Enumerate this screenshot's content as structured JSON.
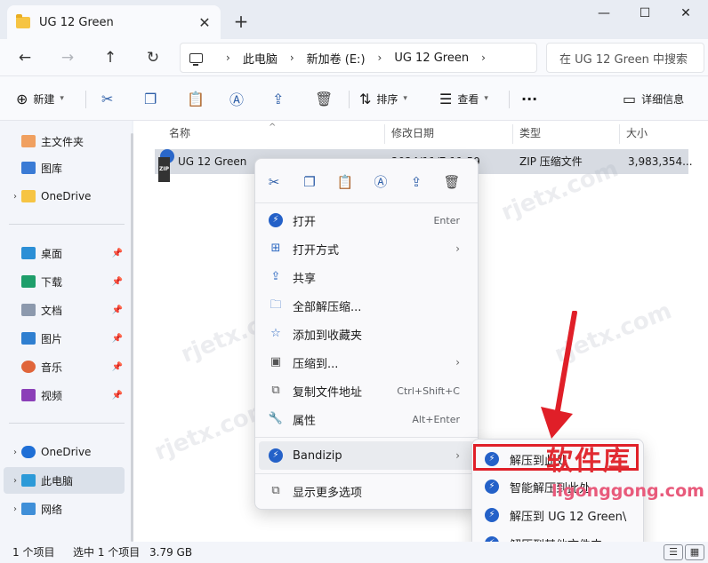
{
  "window": {
    "tab_title": "UG 12 Green",
    "tab_close": "✕",
    "new_tab": "+",
    "minimize": "—",
    "maximize": "☐",
    "close": "✕"
  },
  "nav": {
    "back": "←",
    "forward": "→",
    "up": "↑",
    "refresh": "↻",
    "breadcrumb": [
      "此电脑",
      "新加卷 (E:)",
      "UG 12 Green"
    ],
    "search_placeholder": "在 UG 12 Green 中搜索"
  },
  "toolbar": {
    "new_label": "新建",
    "sort_label": "排序",
    "view_label": "查看",
    "more": "···",
    "details_label": "详细信息"
  },
  "sidebar": {
    "items": [
      {
        "label": "主文件夹"
      },
      {
        "label": "图库"
      },
      {
        "label": "OneDrive"
      },
      {
        "label": "桌面"
      },
      {
        "label": "下载"
      },
      {
        "label": "文档"
      },
      {
        "label": "图片"
      },
      {
        "label": "音乐"
      },
      {
        "label": "视频"
      },
      {
        "label": "OneDrive"
      },
      {
        "label": "此电脑"
      },
      {
        "label": "网络"
      }
    ]
  },
  "columns": {
    "name": "名称",
    "modified": "修改日期",
    "type": "类型",
    "size": "大小"
  },
  "file": {
    "name": "UG 12 Green",
    "modified": "2024/11/7 11:59",
    "type": "ZIP 压缩文件",
    "size": "3,983,354..."
  },
  "status": {
    "count": "1 个项目",
    "selected": "选中 1 个项目",
    "size": "3.79 GB"
  },
  "context_menu": {
    "items": [
      {
        "label": "打开",
        "shortcut": "Enter"
      },
      {
        "label": "打开方式",
        "shortcut": ""
      },
      {
        "label": "共享",
        "shortcut": ""
      },
      {
        "label": "全部解压缩...",
        "shortcut": ""
      },
      {
        "label": "添加到收藏夹",
        "shortcut": ""
      },
      {
        "label": "压缩到...",
        "shortcut": ""
      },
      {
        "label": "复制文件地址",
        "shortcut": "Ctrl+Shift+C"
      },
      {
        "label": "属性",
        "shortcut": "Alt+Enter"
      },
      {
        "label": "Bandizip",
        "shortcut": ""
      },
      {
        "label": "显示更多选项",
        "shortcut": ""
      }
    ]
  },
  "submenu": {
    "items": [
      {
        "label": "解压到此处"
      },
      {
        "label": "智能解压到此处"
      },
      {
        "label": "解压到 UG 12 Green\\"
      },
      {
        "label": "解压到其他文件夹..."
      }
    ]
  },
  "watermark": {
    "brand_cn": "软件库",
    "brand_url": "ligonggong.com"
  },
  "colors": {
    "accent": "#2461c8",
    "highlight_red": "#e01f28",
    "selection": "#d7dbe2"
  }
}
